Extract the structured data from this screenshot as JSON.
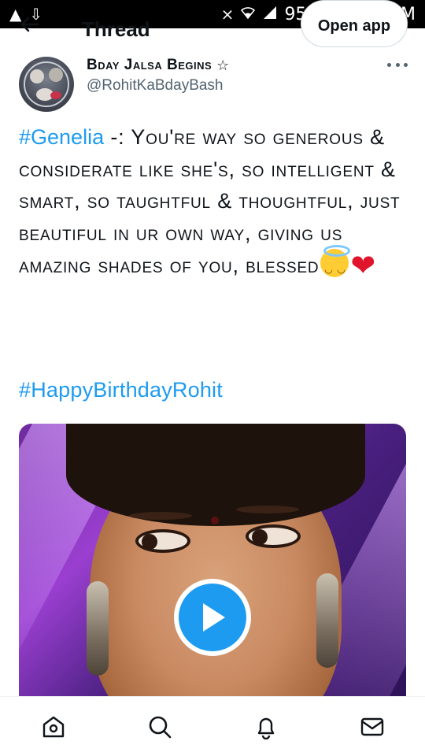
{
  "status_bar": {
    "left_icons": [
      "warning-icon",
      "usb-download-icon"
    ],
    "right_icons": [
      "mute-vibrate-icon",
      "wifi-icon",
      "signal-icon"
    ],
    "battery_percent": "95%",
    "time": "6:22 PM"
  },
  "header": {
    "title": "Thread",
    "open_app_label": "Open app"
  },
  "tweet": {
    "author_name": "Bday Jalsa Begins",
    "author_badge": "☆",
    "author_handle": "@RohitKaBdayBash",
    "more_label": "•••",
    "hashtag_1": "#Genelia",
    "body": " -: You're way so generous & considerate like she's, so intelligent & smart, so taughtful & thoughtful, just beautiful in ur own way, giving us amazing shades of you, blessed",
    "emoji_halo": "smiling-face-with-halo-icon",
    "emoji_heart": "❤",
    "hashtag_2": "#HappyBirthdayRohit"
  },
  "media": {
    "type": "video",
    "play_icon": "play-icon"
  },
  "bottom_nav": {
    "items": [
      "home-icon",
      "search-icon",
      "notifications-icon",
      "messages-icon"
    ]
  },
  "colors": {
    "accent": "#1d9bf0",
    "text": "#0f1419",
    "muted": "#536471",
    "heart": "#e0142a"
  }
}
